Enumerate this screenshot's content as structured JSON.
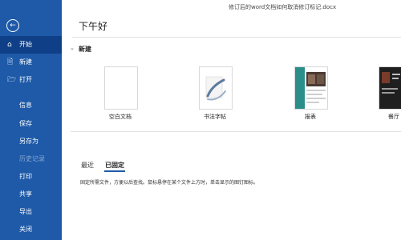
{
  "window": {
    "filename": "修订后的word文档如何取消修订标记.docx"
  },
  "sidebar": {
    "back_icon": "back-arrow-icon",
    "items": [
      {
        "label": "开始",
        "icon": "home-icon",
        "active": true
      },
      {
        "label": "新建",
        "icon": "new-document-icon"
      },
      {
        "label": "打开",
        "icon": "folder-open-icon"
      }
    ],
    "sub_items": [
      {
        "label": "信息"
      },
      {
        "label": "保存"
      },
      {
        "label": "另存为"
      },
      {
        "label": "历史记录",
        "disabled": true
      },
      {
        "label": "打印"
      },
      {
        "label": "共享"
      },
      {
        "label": "导出"
      },
      {
        "label": "关闭"
      }
    ],
    "bg_color": "#1e5aa8"
  },
  "main": {
    "greeting": "下午好",
    "new_section": {
      "title": "新建"
    },
    "templates": [
      {
        "label": "空白文档",
        "thumb": "blank"
      },
      {
        "label": "书法字帖",
        "thumb": "calligraphy"
      },
      {
        "label": "报表",
        "thumb": "report"
      },
      {
        "label": "餐厅",
        "thumb": "dark-menu"
      }
    ],
    "tabs": [
      {
        "label": "最近"
      },
      {
        "label": "已固定",
        "selected": true
      }
    ],
    "pinned_hint": "固定所需文件，方便以后查找。鼠标悬停在某个文件上方时，单击显示的图钉图标。"
  }
}
